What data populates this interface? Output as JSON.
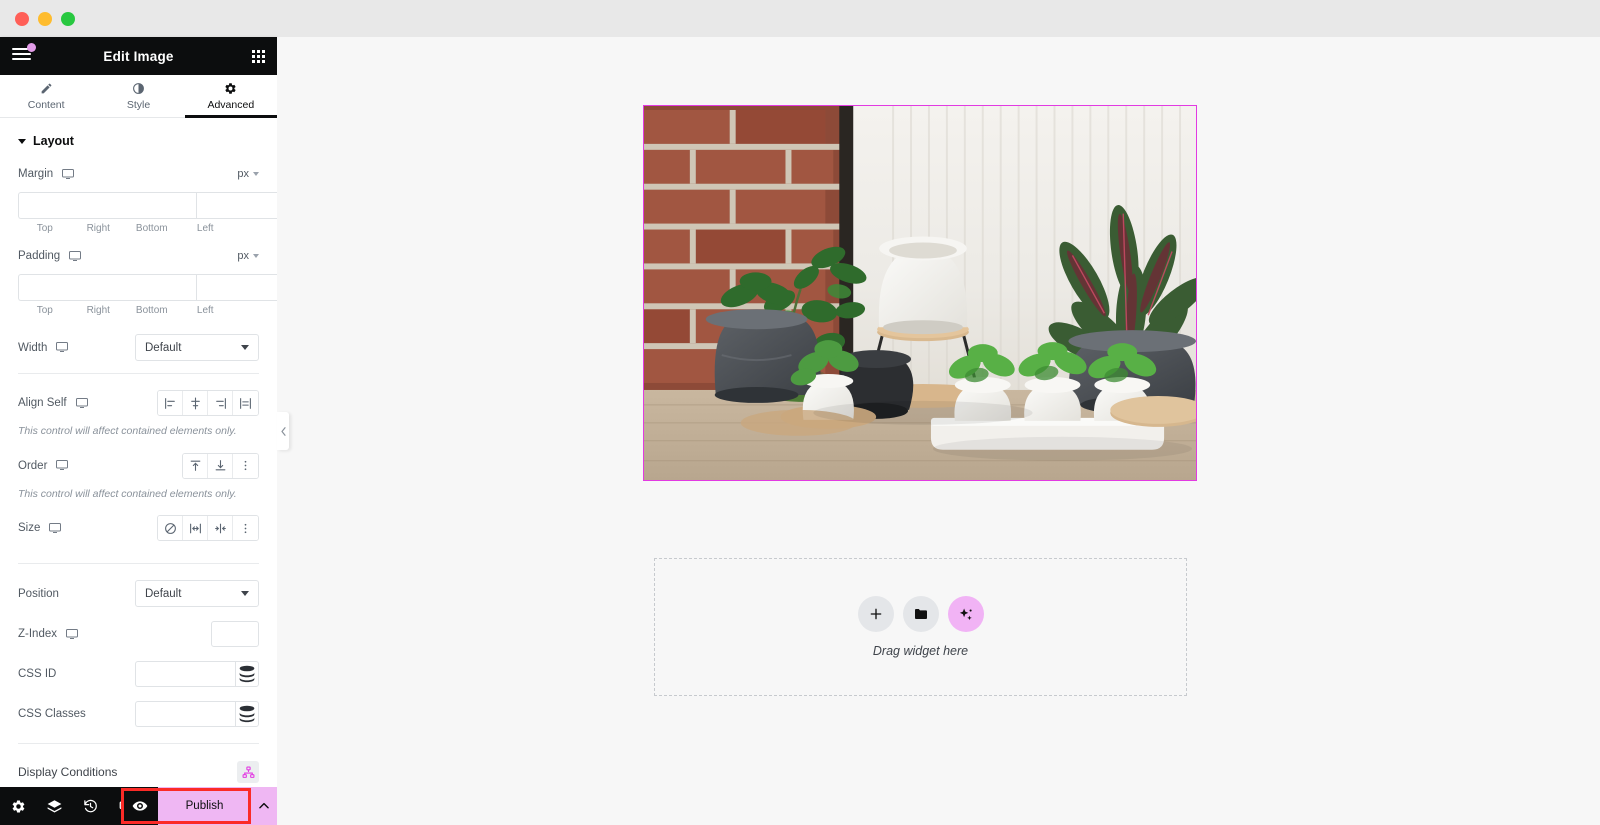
{
  "window": {
    "traffic_lights": [
      "close",
      "minimize",
      "zoom"
    ],
    "chrome_bg": "#e8e8e8"
  },
  "panel": {
    "header": {
      "title": "Edit Image",
      "menu_icon": "hamburger-icon",
      "notification_dot_color": "#e39ce8",
      "apps_icon": "apps-grid-icon",
      "bg": "#0c0d0e"
    },
    "tabs": [
      {
        "label": "Content",
        "icon": "pencil-icon",
        "active": false
      },
      {
        "label": "Style",
        "icon": "contrast-circle-icon",
        "active": false
      },
      {
        "label": "Advanced",
        "icon": "gear-icon",
        "active": true
      }
    ],
    "section": {
      "title": "Layout",
      "expanded": true
    },
    "margin": {
      "label": "Margin",
      "unit": "px",
      "values": [
        "",
        "",
        "",
        ""
      ],
      "sides": [
        "Top",
        "Right",
        "Bottom",
        "Left"
      ],
      "linked": true
    },
    "padding": {
      "label": "Padding",
      "unit": "px",
      "values": [
        "",
        "",
        "",
        ""
      ],
      "sides": [
        "Top",
        "Right",
        "Bottom",
        "Left"
      ],
      "linked": true
    },
    "width": {
      "label": "Width",
      "value": "Default"
    },
    "align_self": {
      "label": "Align Self",
      "options": [
        "start",
        "center",
        "end",
        "stretch"
      ],
      "note": "This control will affect contained elements only."
    },
    "order": {
      "label": "Order",
      "options": [
        "start",
        "end",
        "custom"
      ],
      "note": "This control will affect contained elements only."
    },
    "size": {
      "label": "Size",
      "options": [
        "none",
        "grow",
        "shrink",
        "custom"
      ]
    },
    "position": {
      "label": "Position",
      "value": "Default"
    },
    "z_index": {
      "label": "Z-Index",
      "value": ""
    },
    "css_id": {
      "label": "CSS ID",
      "value": "",
      "placeholder": ""
    },
    "css_classes": {
      "label": "CSS Classes",
      "value": "",
      "placeholder": ""
    },
    "display_conditions": {
      "label": "Display Conditions",
      "icon": "sitemap-icon",
      "icon_color": "#e23ae2"
    },
    "collapse": {
      "icon": "chevron-left-icon"
    }
  },
  "footer": {
    "items": [
      {
        "name": "settings",
        "icon": "gear-icon"
      },
      {
        "name": "navigator",
        "icon": "layers-icon"
      },
      {
        "name": "history",
        "icon": "history-clock-icon"
      },
      {
        "name": "responsive",
        "icon": "responsive-devices-icon"
      }
    ],
    "preview": {
      "label": "",
      "icon": "eye-icon"
    },
    "publish": {
      "label": "Publish",
      "bg": "#efb7f3"
    },
    "publish_more": {
      "icon": "chevron-up-icon"
    },
    "highlight_color": "#fb2b27"
  },
  "canvas": {
    "bg": "#f7f7f7",
    "image_widget": {
      "name": "image-widget",
      "selected": true,
      "selection_color": "#e23ae2",
      "alt": "Indoor potted plants on wooden floor against a brick wall with white curtains"
    },
    "drop_zone": {
      "label": "Drag widget here",
      "buttons": [
        {
          "name": "add-element",
          "icon": "plus-icon"
        },
        {
          "name": "add-template",
          "icon": "folder-icon"
        },
        {
          "name": "ai-builder",
          "icon": "sparkles-icon",
          "bg": "#f1b3f5"
        }
      ]
    }
  }
}
